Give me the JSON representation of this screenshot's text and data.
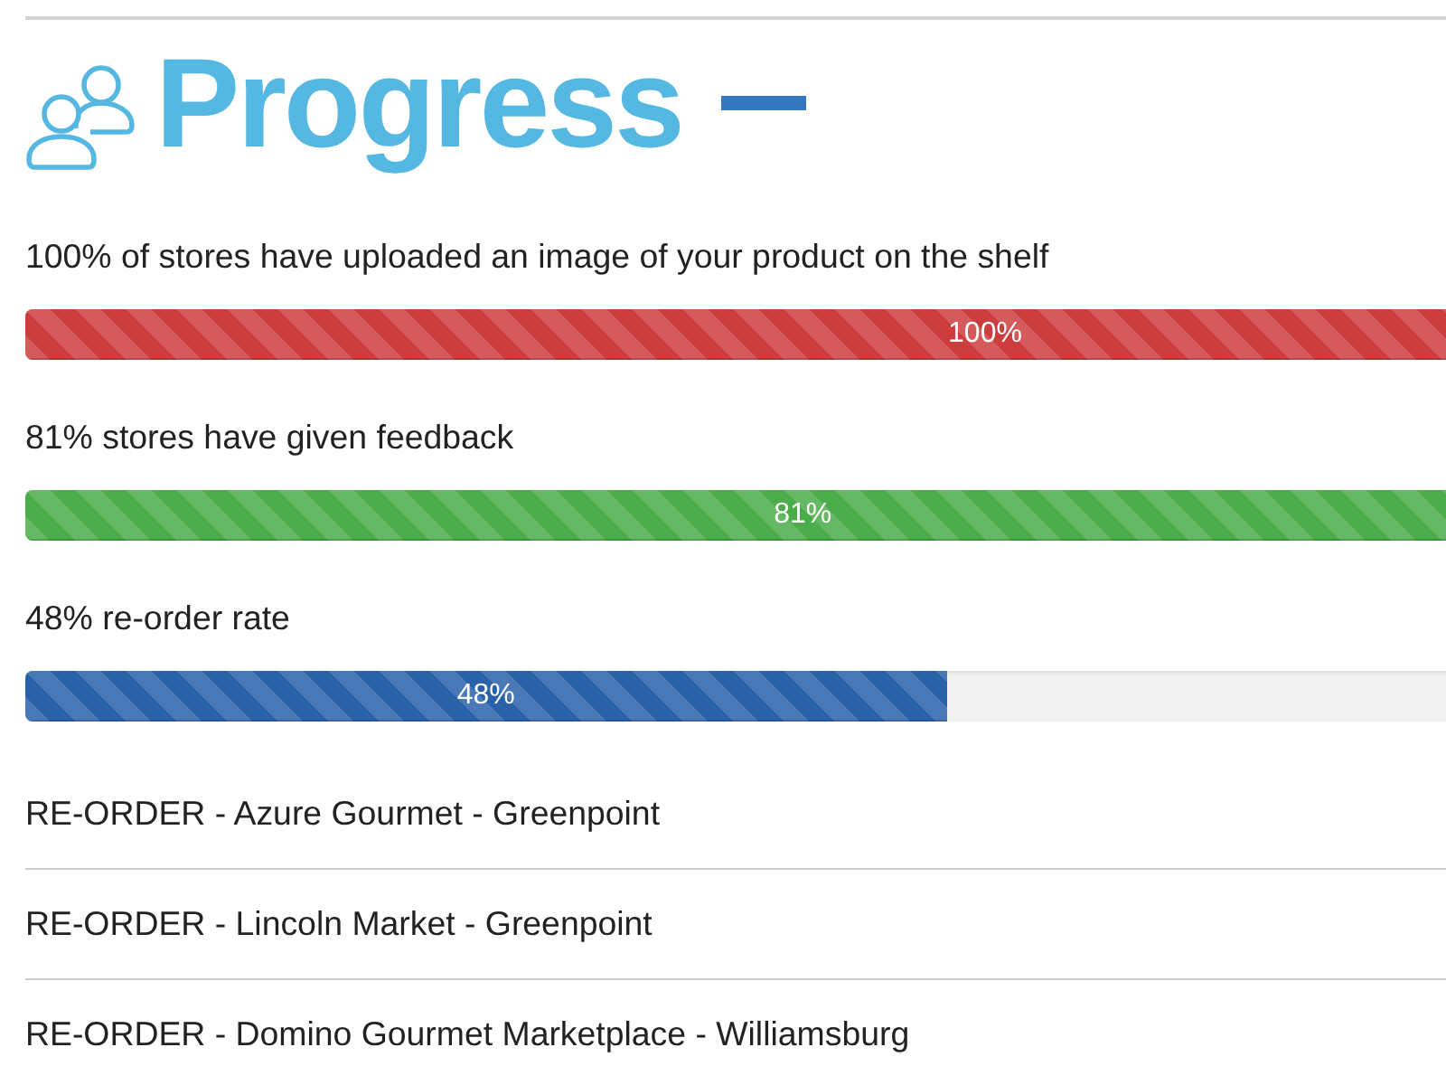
{
  "panel": {
    "title": "Progress",
    "expanded": true
  },
  "metrics": [
    {
      "label": "100% of stores have uploaded an image of your product on the shelf",
      "level": 1,
      "reading": "100%",
      "color": "#cd3d3e"
    },
    {
      "label": "81% stores have given feedback",
      "level": 0.81,
      "reading": "81%",
      "color": "#4aad4a"
    },
    {
      "label": "48% re-order rate",
      "level": 0.48,
      "reading": "48%",
      "color": "#2a62aa"
    }
  ],
  "reorders": [
    "RE-ORDER - Azure Gourmet - Greenpoint",
    "RE-ORDER - Lincoln Market - Greenpoint",
    "RE-ORDER - Domino Gourmet Marketplace - Williamsburg"
  ]
}
